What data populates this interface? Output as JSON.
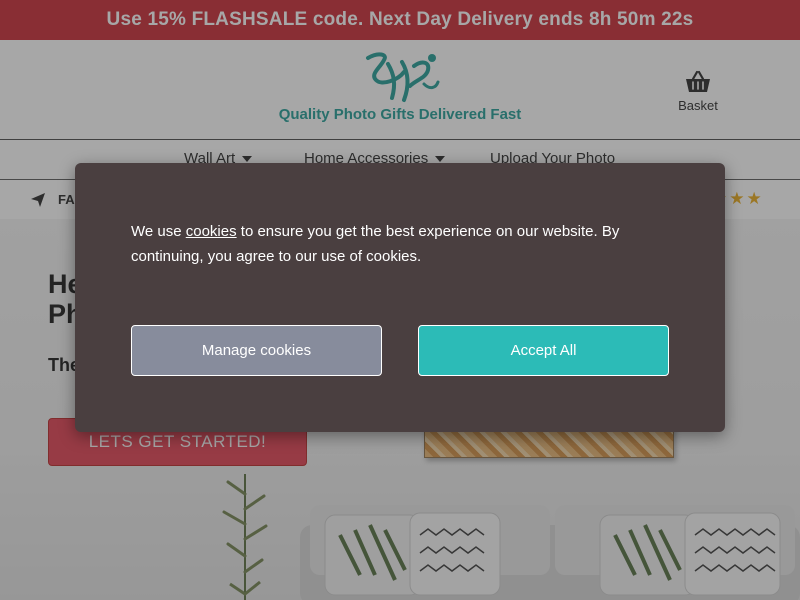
{
  "promo": {
    "text": "Use 15% FLASHSALE code. Next Day Delivery ends 8h 50m 22s"
  },
  "header": {
    "tagline": "Quality Photo Gifts Delivered Fast",
    "basket_label": "Basket"
  },
  "nav": {
    "items": [
      {
        "label": "Wall Art",
        "has_dropdown": true
      },
      {
        "label": "Home Accessories",
        "has_dropdown": true
      },
      {
        "label": "Upload Your Photo",
        "has_dropdown": false
      }
    ]
  },
  "infobar": {
    "left_text": "FA",
    "rating_stars": 3
  },
  "hero": {
    "title_line1": "He",
    "title_line2": "Ph",
    "subtitle": "The",
    "cta_label": "LETS GET STARTED!"
  },
  "cookie_modal": {
    "text_before_link": "We use ",
    "link_text": "cookies",
    "text_after_link": " to ensure you get the best experience on our website. By continuing, you agree to our use of cookies.",
    "manage_label": "Manage cookies",
    "accept_label": "Accept All"
  },
  "colors": {
    "promo_bg": "#c8242e",
    "brand_teal": "#1a9a92",
    "accept_button": "#2cbbb7",
    "manage_button": "#878c9c",
    "modal_bg": "#4a3f40",
    "cta_red": "#e23b4e",
    "star_gold": "#e9a813"
  }
}
